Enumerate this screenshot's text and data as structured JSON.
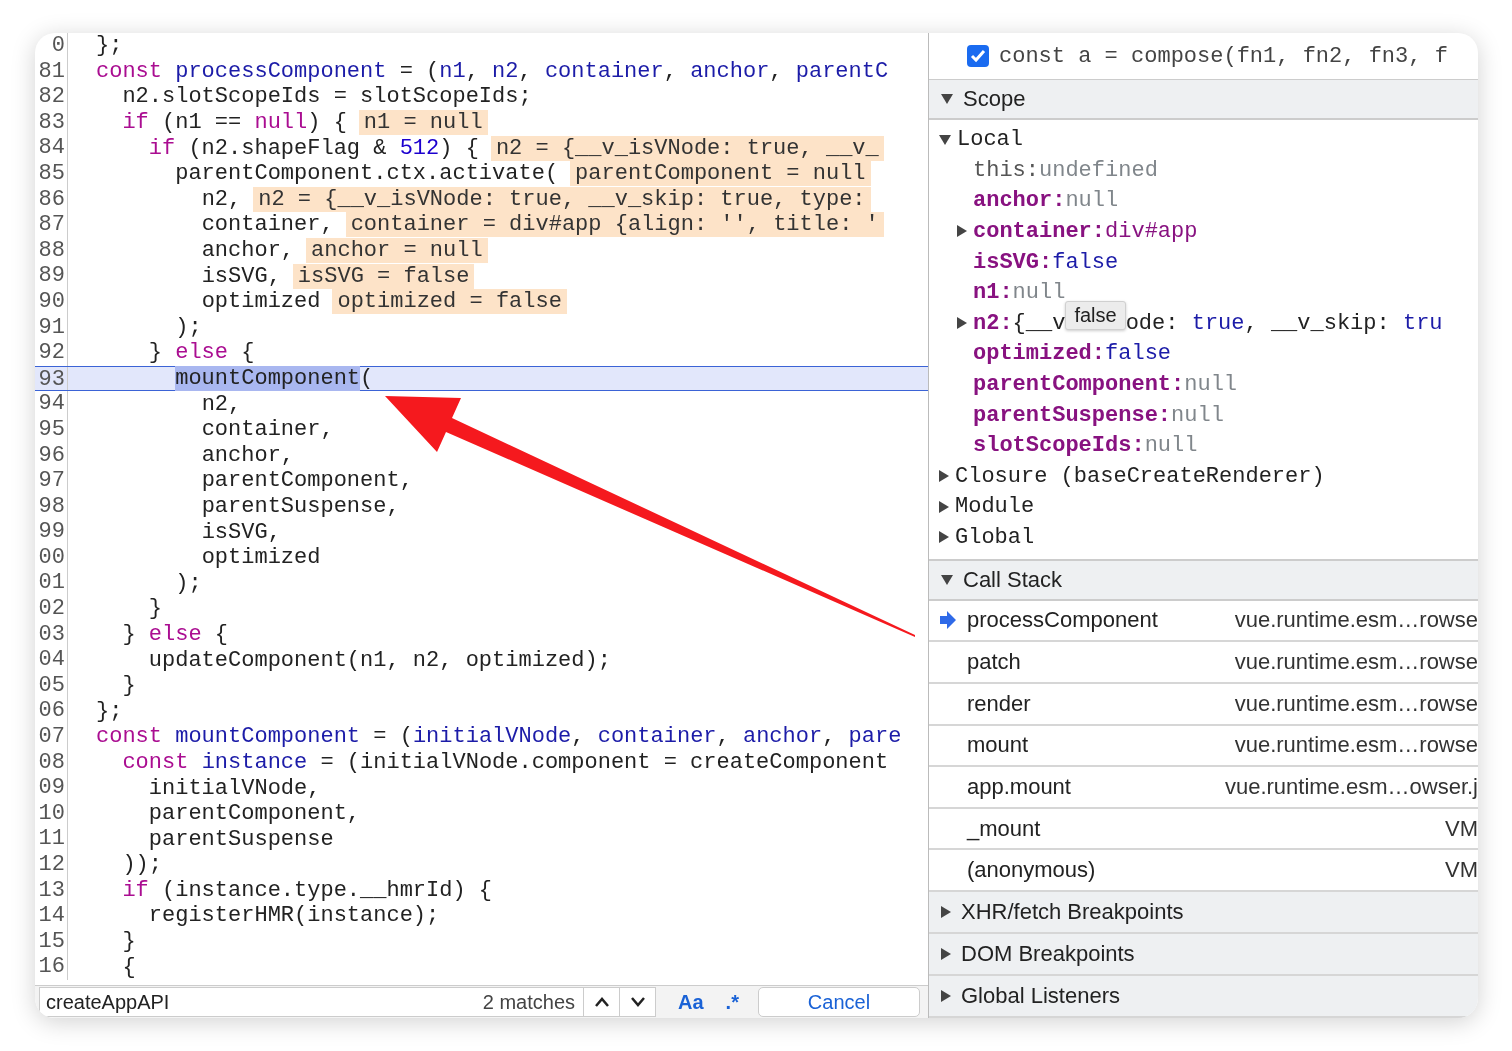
{
  "editor": {
    "lines": [
      {
        "number": "0",
        "current": false,
        "tokens": [
          {
            "kind": "plain",
            "text": "};"
          }
        ]
      },
      {
        "number": "81",
        "current": false,
        "tokens": [
          {
            "kind": "keyword",
            "text": "const"
          },
          {
            "kind": "def",
            "text": " processComponent"
          },
          {
            "kind": "plain",
            "text": " = ("
          },
          {
            "kind": "def",
            "text": "n1"
          },
          {
            "kind": "plain",
            "text": ", "
          },
          {
            "kind": "def",
            "text": "n2"
          },
          {
            "kind": "plain",
            "text": ", "
          },
          {
            "kind": "def",
            "text": "container"
          },
          {
            "kind": "plain",
            "text": ", "
          },
          {
            "kind": "def",
            "text": "anchor"
          },
          {
            "kind": "plain",
            "text": ", "
          },
          {
            "kind": "def",
            "text": "parentC"
          }
        ]
      },
      {
        "number": "82",
        "current": false,
        "tokens": [
          {
            "kind": "plain",
            "text": "  n2.slotScopeIds = slotScopeIds;"
          }
        ]
      },
      {
        "number": "83",
        "current": false,
        "tokens": [
          {
            "kind": "keyword",
            "text": "  if"
          },
          {
            "kind": "plain",
            "text": " (n1 == "
          },
          {
            "kind": "keyword",
            "text": "null"
          },
          {
            "kind": "plain",
            "text": ") {"
          }
        ],
        "inline_value": "n1 = null"
      },
      {
        "number": "84",
        "current": false,
        "tokens": [
          {
            "kind": "keyword",
            "text": "    if"
          },
          {
            "kind": "plain",
            "text": " (n2.shapeFlag & "
          },
          {
            "kind": "number",
            "text": "512"
          },
          {
            "kind": "plain",
            "text": ") {"
          }
        ],
        "inline_value": "n2 = {__v_isVNode: true, __v_"
      },
      {
        "number": "85",
        "current": false,
        "tokens": [
          {
            "kind": "plain",
            "text": "      parentComponent.ctx.activate("
          }
        ],
        "inline_value": "parentComponent = null"
      },
      {
        "number": "86",
        "current": false,
        "tokens": [
          {
            "kind": "plain",
            "text": "        n2,"
          }
        ],
        "inline_value": "n2 = {__v_isVNode: true, __v_skip: true, type:"
      },
      {
        "number": "87",
        "current": false,
        "tokens": [
          {
            "kind": "plain",
            "text": "        container,"
          }
        ],
        "inline_value": "container = div#app {align: '', title: '"
      },
      {
        "number": "88",
        "current": false,
        "tokens": [
          {
            "kind": "plain",
            "text": "        anchor,"
          }
        ],
        "inline_value": "anchor = null"
      },
      {
        "number": "89",
        "current": false,
        "tokens": [
          {
            "kind": "plain",
            "text": "        isSVG,"
          }
        ],
        "inline_value": "isSVG = false"
      },
      {
        "number": "90",
        "current": false,
        "tokens": [
          {
            "kind": "plain",
            "text": "        optimized"
          }
        ],
        "inline_value": "optimized = false"
      },
      {
        "number": "91",
        "current": false,
        "tokens": [
          {
            "kind": "plain",
            "text": "      );"
          }
        ]
      },
      {
        "number": "92",
        "current": false,
        "tokens": [
          {
            "kind": "plain",
            "text": "    } "
          },
          {
            "kind": "keyword",
            "text": "else"
          },
          {
            "kind": "plain",
            "text": " {"
          }
        ]
      },
      {
        "number": "93",
        "current": true,
        "tokens": [
          {
            "kind": "selected",
            "text": "      mountComponent"
          },
          {
            "kind": "plain",
            "text": "("
          }
        ]
      },
      {
        "number": "94",
        "current": false,
        "tokens": [
          {
            "kind": "plain",
            "text": "        n2,"
          }
        ]
      },
      {
        "number": "95",
        "current": false,
        "tokens": [
          {
            "kind": "plain",
            "text": "        container,"
          }
        ]
      },
      {
        "number": "96",
        "current": false,
        "tokens": [
          {
            "kind": "plain",
            "text": "        anchor,"
          }
        ]
      },
      {
        "number": "97",
        "current": false,
        "tokens": [
          {
            "kind": "plain",
            "text": "        parentComponent,"
          }
        ]
      },
      {
        "number": "98",
        "current": false,
        "tokens": [
          {
            "kind": "plain",
            "text": "        parentSuspense,"
          }
        ]
      },
      {
        "number": "99",
        "current": false,
        "tokens": [
          {
            "kind": "plain",
            "text": "        isSVG,"
          }
        ]
      },
      {
        "number": "00",
        "current": false,
        "tokens": [
          {
            "kind": "plain",
            "text": "        optimized"
          }
        ]
      },
      {
        "number": "01",
        "current": false,
        "tokens": [
          {
            "kind": "plain",
            "text": "      );"
          }
        ]
      },
      {
        "number": "02",
        "current": false,
        "tokens": [
          {
            "kind": "plain",
            "text": "    }"
          }
        ]
      },
      {
        "number": "03",
        "current": false,
        "tokens": [
          {
            "kind": "plain",
            "text": "  } "
          },
          {
            "kind": "keyword",
            "text": "else"
          },
          {
            "kind": "plain",
            "text": " {"
          }
        ]
      },
      {
        "number": "04",
        "current": false,
        "tokens": [
          {
            "kind": "plain",
            "text": "    updateComponent(n1, n2, optimized);"
          }
        ]
      },
      {
        "number": "05",
        "current": false,
        "tokens": [
          {
            "kind": "plain",
            "text": "  }"
          }
        ]
      },
      {
        "number": "06",
        "current": false,
        "tokens": [
          {
            "kind": "plain",
            "text": "};"
          }
        ]
      },
      {
        "number": "07",
        "current": false,
        "tokens": [
          {
            "kind": "keyword",
            "text": "const"
          },
          {
            "kind": "def",
            "text": " mountComponent"
          },
          {
            "kind": "plain",
            "text": " = ("
          },
          {
            "kind": "def",
            "text": "initialVNode"
          },
          {
            "kind": "plain",
            "text": ", "
          },
          {
            "kind": "def",
            "text": "container"
          },
          {
            "kind": "plain",
            "text": ", "
          },
          {
            "kind": "def",
            "text": "anchor"
          },
          {
            "kind": "plain",
            "text": ", "
          },
          {
            "kind": "def",
            "text": "pare"
          }
        ]
      },
      {
        "number": "08",
        "current": false,
        "tokens": [
          {
            "kind": "keyword",
            "text": "  const"
          },
          {
            "kind": "def",
            "text": " instance"
          },
          {
            "kind": "plain",
            "text": " = (initialVNode.component = createComponent"
          }
        ]
      },
      {
        "number": "09",
        "current": false,
        "tokens": [
          {
            "kind": "plain",
            "text": "    initialVNode,"
          }
        ]
      },
      {
        "number": "10",
        "current": false,
        "tokens": [
          {
            "kind": "plain",
            "text": "    parentComponent,"
          }
        ]
      },
      {
        "number": "11",
        "current": false,
        "tokens": [
          {
            "kind": "plain",
            "text": "    parentSuspense"
          }
        ]
      },
      {
        "number": "12",
        "current": false,
        "tokens": [
          {
            "kind": "plain",
            "text": "  ));"
          }
        ]
      },
      {
        "number": "13",
        "current": false,
        "tokens": [
          {
            "kind": "keyword",
            "text": "  if"
          },
          {
            "kind": "plain",
            "text": " (instance.type.__hmrId) {"
          }
        ]
      },
      {
        "number": "14",
        "current": false,
        "tokens": [
          {
            "kind": "plain",
            "text": "    registerHMR(instance);"
          }
        ]
      },
      {
        "number": "15",
        "current": false,
        "tokens": [
          {
            "kind": "plain",
            "text": "  }"
          }
        ]
      },
      {
        "number": "16",
        "current": false,
        "tokens": [
          {
            "kind": "plain",
            "text": "  {"
          }
        ]
      }
    ]
  },
  "search": {
    "query": "createAppAPI",
    "matches": "2 matches",
    "case_label": "Aa",
    "regex_label": ".*",
    "cancel": "Cancel"
  },
  "watch": {
    "checked": true,
    "expression": "const a = compose(fn1, fn2, fn3, f"
  },
  "scope": {
    "title": "Scope",
    "expanded": true,
    "groups": [
      {
        "label": "Local",
        "expanded": true,
        "entries": [
          {
            "key": "this:",
            "kind": "receiver",
            "value": "undefined",
            "color": "#80868b",
            "expandable": false
          },
          {
            "key": "anchor:",
            "kind": "property",
            "value": "null",
            "color": "#80868b",
            "expandable": false
          },
          {
            "key": "container:",
            "kind": "property",
            "value": "div#app",
            "color": "#881280",
            "expandable": true
          },
          {
            "key": "isSVG:",
            "kind": "property",
            "value": "false",
            "color": "#1c1ca8",
            "expandable": false
          },
          {
            "key": "n1:",
            "kind": "property",
            "value": "null",
            "color": "#80868b",
            "expandable": false
          },
          {
            "key": "n2:",
            "kind": "property",
            "value": "{__v",
            "color": "#222222",
            "value_rest": "ode: true, __v_skip: tru",
            "tooltip": "false",
            "expandable": true
          },
          {
            "key": "optimized:",
            "kind": "property",
            "value": "false",
            "color": "#1c1ca8",
            "expandable": false
          },
          {
            "key": "parentComponent:",
            "kind": "property",
            "value": "null",
            "color": "#80868b",
            "expandable": false
          },
          {
            "key": "parentSuspense:",
            "kind": "property",
            "value": "null",
            "color": "#80868b",
            "expandable": false
          },
          {
            "key": "slotScopeIds:",
            "kind": "property",
            "value": "null",
            "color": "#80868b",
            "expandable": false
          }
        ]
      },
      {
        "label": "Closure (baseCreateRenderer)",
        "expanded": false
      },
      {
        "label": "Module",
        "expanded": false
      },
      {
        "label": "Global",
        "expanded": false
      }
    ]
  },
  "call_stack": {
    "title": "Call Stack",
    "expanded": true,
    "frames": [
      {
        "name": "processComponent",
        "location": "vue.runtime.esm…rowse",
        "current": true
      },
      {
        "name": "patch",
        "location": "vue.runtime.esm…rowse",
        "current": false
      },
      {
        "name": "render",
        "location": "vue.runtime.esm…rowse",
        "current": false
      },
      {
        "name": "mount",
        "location": "vue.runtime.esm…rowse",
        "current": false
      },
      {
        "name": "app.mount",
        "location": "vue.runtime.esm…owser.j",
        "current": false
      },
      {
        "name": "_mount",
        "location": "VM",
        "current": false
      },
      {
        "name": "(anonymous)",
        "location": "VM",
        "current": false
      }
    ]
  },
  "sections": [
    {
      "title": "XHR/fetch Breakpoints",
      "expanded": false
    },
    {
      "title": "DOM Breakpoints",
      "expanded": false
    },
    {
      "title": "Global Listeners",
      "expanded": false
    }
  ]
}
